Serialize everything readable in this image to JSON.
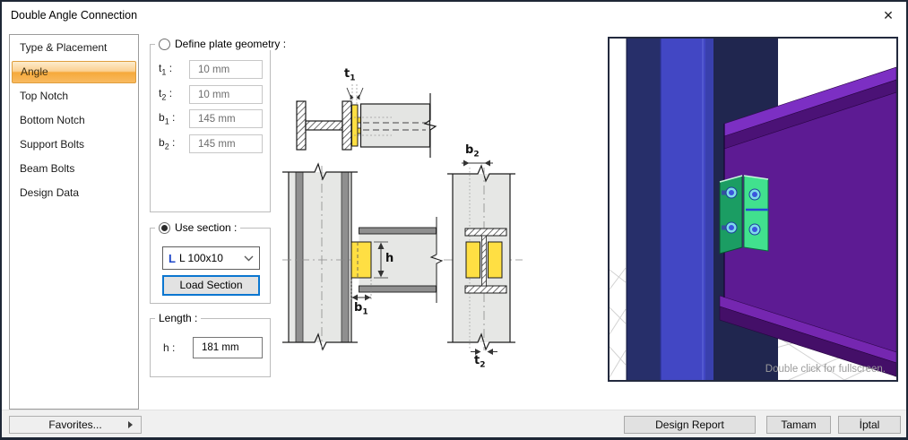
{
  "window": {
    "title": "Double Angle Connection",
    "close_icon": "✕"
  },
  "sidebar": {
    "items": [
      {
        "label": "Type & Placement",
        "selected": false
      },
      {
        "label": "Angle",
        "selected": true
      },
      {
        "label": "Top Notch",
        "selected": false
      },
      {
        "label": "Bottom Notch",
        "selected": false
      },
      {
        "label": "Support Bolts",
        "selected": false
      },
      {
        "label": "Beam Bolts",
        "selected": false
      },
      {
        "label": "Design Data",
        "selected": false
      }
    ]
  },
  "plate_geometry": {
    "radio_label": "Define plate geometry :",
    "selected": false,
    "fields": [
      {
        "name": "t",
        "sub": "1",
        "suffix": ":",
        "value": "10 mm"
      },
      {
        "name": "t",
        "sub": "2",
        "suffix": ":",
        "value": "10 mm"
      },
      {
        "name": "b",
        "sub": "1",
        "suffix": ":",
        "value": "145 mm"
      },
      {
        "name": "b",
        "sub": "2",
        "suffix": ":",
        "value": "145 mm"
      }
    ]
  },
  "use_section": {
    "radio_label": "Use section :",
    "selected": true,
    "section_icon": "L",
    "selected_section": "L 100x10",
    "load_button_label": "Load Section"
  },
  "length": {
    "group_label": "Length :",
    "field_label": "h :",
    "value": "181 mm"
  },
  "diagram_labels": {
    "t1": {
      "main": "t",
      "sub": "1"
    },
    "t2": {
      "main": "t",
      "sub": "2"
    },
    "b1": {
      "main": "b",
      "sub": "1"
    },
    "b2": {
      "main": "b",
      "sub": "2"
    },
    "h": {
      "main": "h",
      "sub": ""
    }
  },
  "viewport": {
    "hint": "Double click for fullscreen."
  },
  "footer": {
    "favorites_label": "Favorites...",
    "design_report_label": "Design Report",
    "ok_label": "Tamam",
    "cancel_label": "İptal"
  },
  "colors": {
    "selection_orange": "#F5A93C",
    "angle_plate_yellow": "#FFDF43",
    "column_blue": "#4247C4",
    "beam_purple": "#5D1B93",
    "angle_green": "#41E18E",
    "focus_blue": "#0B76D0"
  }
}
